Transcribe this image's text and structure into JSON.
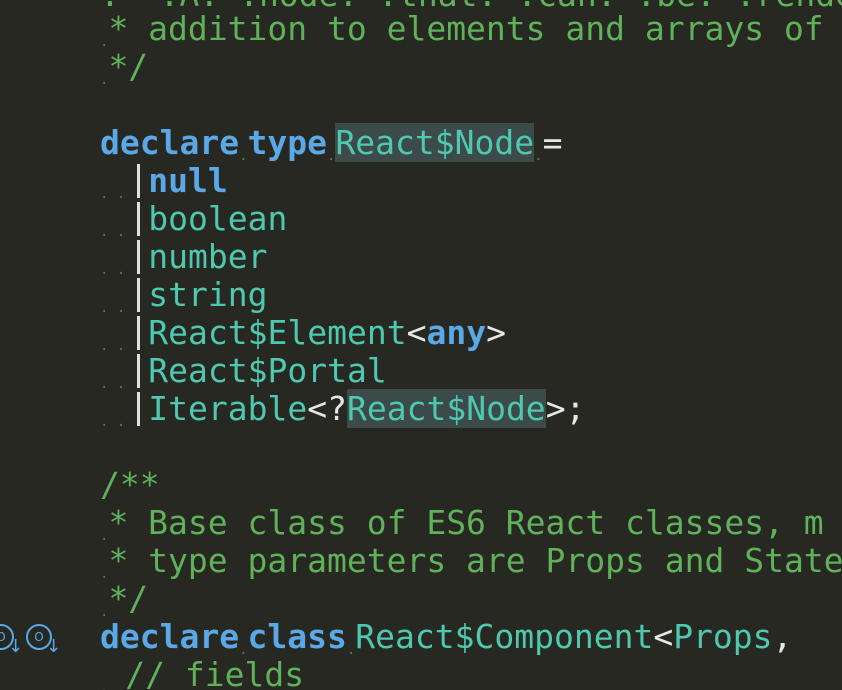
{
  "code": {
    "l1": "* addition to elements and arrays of",
    "l2": "*/",
    "decl_kw": "declare",
    "type_kw": "type",
    "node_name": "React$Node",
    "eq": "=",
    "u1": "null",
    "u2": "boolean",
    "u3": "number",
    "u4": "string",
    "u5a": "React$Element",
    "u5b": "<",
    "u5c": "any",
    "u5d": ">",
    "u6": "React$Portal",
    "u7a": "Iterable",
    "u7b": "<?",
    "u7c": "React$Node",
    "u7d": ">;",
    "c_open": "/**",
    "c1": "* Base class of ES6 React classes, m",
    "c2": "* type parameters are Props and State",
    "c3": "*/",
    "class_decl_kw": "declare",
    "class_kw": "class",
    "class_name": "React$Component",
    "class_lt": "<",
    "class_props": "Props",
    "class_comma": ",",
    "fields_comment": "// fields"
  },
  "gutter": {
    "icon1": "O",
    "icon2": "O"
  }
}
